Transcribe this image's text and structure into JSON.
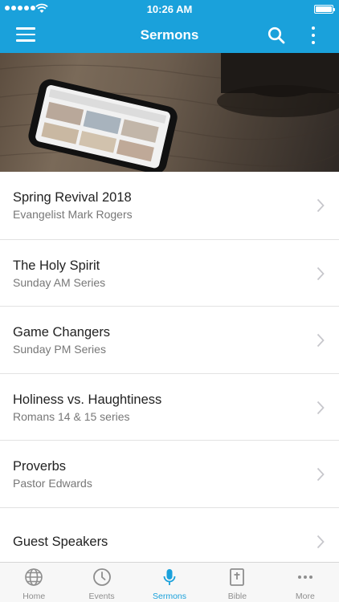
{
  "status_bar": {
    "time": "10:26 AM"
  },
  "nav": {
    "title": "Sermons"
  },
  "sermons": [
    {
      "title": "Spring Revival 2018",
      "subtitle": "Evangelist Mark Rogers"
    },
    {
      "title": "The Holy Spirit",
      "subtitle": "Sunday AM Series"
    },
    {
      "title": "Game Changers",
      "subtitle": "Sunday PM Series"
    },
    {
      "title": "Holiness vs. Haughtiness",
      "subtitle": "Romans 14 & 15 series"
    },
    {
      "title": "Proverbs",
      "subtitle": "Pastor Edwards"
    },
    {
      "title": "Guest Speakers",
      "subtitle": ""
    }
  ],
  "tab_bar": {
    "tabs": [
      {
        "label": "Home",
        "icon": "globe-icon",
        "active": false
      },
      {
        "label": "Events",
        "icon": "clock-icon",
        "active": false
      },
      {
        "label": "Sermons",
        "icon": "microphone-icon",
        "active": true
      },
      {
        "label": "Bible",
        "icon": "bible-icon",
        "active": false
      },
      {
        "label": "More",
        "icon": "ellipsis-icon",
        "active": false
      }
    ]
  },
  "colors": {
    "accent": "#1aa1db",
    "tab_inactive": "#8e8e8e",
    "divider": "#e2e2e2"
  }
}
